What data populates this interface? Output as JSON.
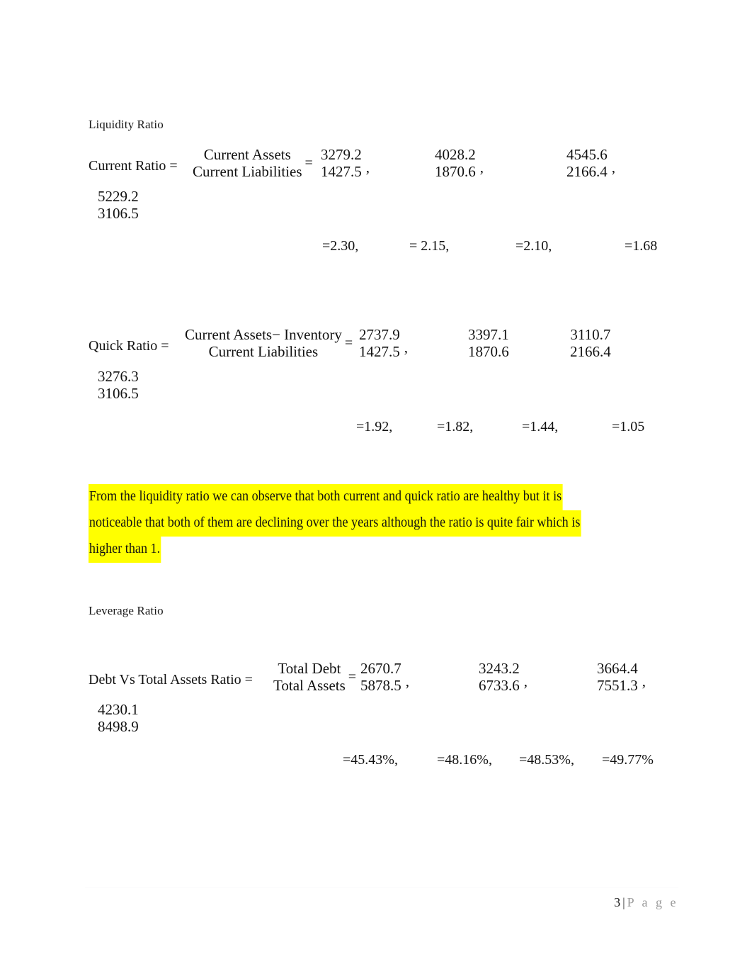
{
  "document": {
    "footer": {
      "page_number": "3",
      "separator": "|",
      "page_word": "P a g e"
    }
  },
  "sections": [
    {
      "heading": "Liquidity Ratio",
      "formulas": [
        {
          "label": "Current Ratio =",
          "numerator_expr": "Current Assets",
          "denominator_expr": "Current Liabilities",
          "equals": "=",
          "fractions": [
            {
              "num": "3279.2",
              "den": "1427.5",
              "comma": ","
            },
            {
              "num": "4028.2",
              "den": "1870.6",
              "comma": ","
            },
            {
              "num": "4545.6",
              "den": "2166.4",
              "comma": ","
            },
            {
              "num": "5229.2",
              "den": "3106.5",
              "comma": ""
            }
          ],
          "results": [
            "=2.30,",
            "= 2.15,",
            "=2.10,",
            "=1.68"
          ]
        },
        {
          "label": "Quick Ratio =",
          "numerator_expr": "Current Assets− Inventory",
          "denominator_expr": "Current Liabilities",
          "equals": "=",
          "fractions": [
            {
              "num": "2737.9",
              "den": "1427.5",
              "comma": ","
            },
            {
              "num": "3397.1",
              "den": "1870.6",
              "comma": ""
            },
            {
              "num": "3110.7",
              "den": "2166.4",
              "comma": ""
            },
            {
              "num": "3276.3",
              "den": "3106.5",
              "comma": ""
            }
          ],
          "results": [
            "=1.92,",
            "=1.82,",
            "=1.44,",
            "=1.05"
          ]
        }
      ],
      "commentary": {
        "lines": [
          "From the liquidity ratio we can observe that both current and quick ratio are healthy but it is",
          "noticeable that both of them are declining over the years although the ratio is quite fair which is",
          "higher than 1."
        ],
        "highlight_color": "#ffff00"
      }
    },
    {
      "heading": "Leverage Ratio",
      "formulas": [
        {
          "label": "Debt Vs Total Assets Ratio =",
          "numerator_expr": "Total Debt",
          "denominator_expr": "Total Assets",
          "equals": "=",
          "fractions": [
            {
              "num": "2670.7",
              "den": "5878.5",
              "comma": ","
            },
            {
              "num": "3243.2",
              "den": "6733.6",
              "comma": ","
            },
            {
              "num": "3664.4",
              "den": "7551.3",
              "comma": ","
            },
            {
              "num": "4230.1",
              "den": "8498.9",
              "comma": ""
            }
          ],
          "results": [
            "=45.43%,",
            "=48.16%,",
            "=48.53%,",
            "=49.77%"
          ]
        }
      ]
    }
  ]
}
